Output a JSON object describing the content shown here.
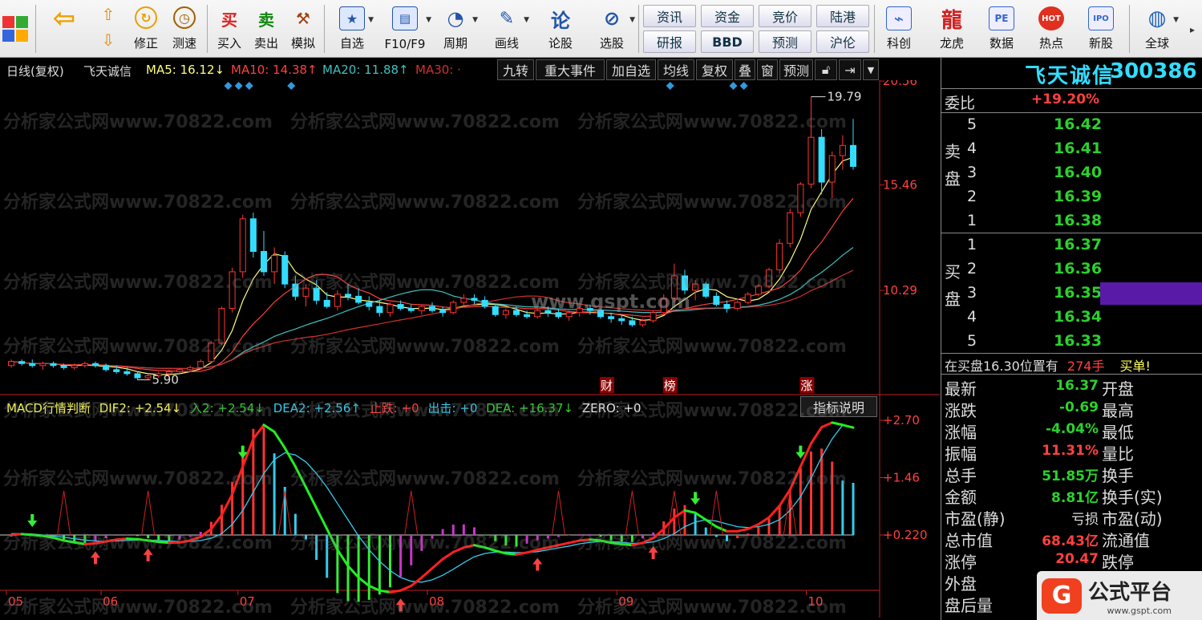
{
  "toolbar": {
    "buttons": [
      {
        "name": "back",
        "label": ""
      },
      {
        "name": "revise",
        "label": "修正"
      },
      {
        "name": "speed-test",
        "label": "测速"
      },
      {
        "name": "buy",
        "label": "买入"
      },
      {
        "name": "sell",
        "label": "卖出"
      },
      {
        "name": "simulate",
        "label": "模拟"
      },
      {
        "name": "self-select",
        "label": "自选"
      },
      {
        "name": "f10",
        "label": "F10/F9"
      },
      {
        "name": "period",
        "label": "周期"
      },
      {
        "name": "draw-line",
        "label": "画线"
      },
      {
        "name": "stock-forum",
        "label": "论股"
      },
      {
        "name": "stock-select",
        "label": "选股"
      },
      {
        "name": "kechuang",
        "label": "科创"
      },
      {
        "name": "dragon-tiger",
        "label": "龙虎"
      },
      {
        "name": "data",
        "label": "数据"
      },
      {
        "name": "hotspot",
        "label": "热点"
      },
      {
        "name": "new-stock",
        "label": "新股"
      },
      {
        "name": "global",
        "label": "全球"
      }
    ],
    "text_buttons": [
      "资讯",
      "资金",
      "竞价",
      "陆港",
      "研报",
      "BBD",
      "预测",
      "沪伦"
    ],
    "icon_glyphs": {
      "buy": "买",
      "sell": "卖",
      "stock-forum": "论",
      "pe": "PE",
      "ipo": "IPO",
      "hot": "HOT"
    }
  },
  "header": {
    "period_label": "日线(复权)",
    "stock_name": "飞天诚信",
    "ma5": "MA5: 16.12↓",
    "ma10": "MA10: 14.38↑",
    "ma20": "MA20: 11.88↑",
    "ma30": "MA30: ·",
    "buttons": [
      "九转",
      "重大事件",
      "加自选",
      "均线",
      "复权",
      "叠",
      "窗",
      "预测"
    ]
  },
  "title": {
    "name": "飞天诚信",
    "code": "300386"
  },
  "order_ratio": {
    "label": "委比",
    "value": "+19.20%"
  },
  "sell_side": {
    "label": "卖盘",
    "levels": [
      {
        "n": "5",
        "price": "16.42"
      },
      {
        "n": "4",
        "price": "16.41"
      },
      {
        "n": "3",
        "price": "16.40"
      },
      {
        "n": "2",
        "price": "16.39"
      },
      {
        "n": "1",
        "price": "16.38"
      }
    ]
  },
  "buy_side": {
    "label": "买盘",
    "levels": [
      {
        "n": "1",
        "price": "16.37"
      },
      {
        "n": "2",
        "price": "16.36"
      },
      {
        "n": "3",
        "price": "16.35"
      },
      {
        "n": "4",
        "price": "16.34"
      },
      {
        "n": "5",
        "price": "16.33"
      }
    ]
  },
  "notice": {
    "prefix": "在买盘16.30位置有",
    "qty": "274手",
    "suffix": "买单!"
  },
  "quote": {
    "latest": {
      "label": "最新",
      "value": "16.37",
      "right": "开盘"
    },
    "change": {
      "label": "涨跌",
      "value": "-0.69",
      "right": "最高"
    },
    "change_pct": {
      "label": "涨幅",
      "value": "-4.04%",
      "right": "最低"
    },
    "amplitude": {
      "label": "振幅",
      "value": "11.31%",
      "right": "量比"
    },
    "volume": {
      "label": "总手",
      "value": "51.85万",
      "right": "换手"
    },
    "amount": {
      "label": "金额",
      "value": "8.81亿",
      "right": "换手(实)"
    },
    "pe_static": {
      "label": "市盈(静)",
      "value": "亏损",
      "right": "市盈(动)"
    },
    "market_cap": {
      "label": "总市值",
      "value": "68.43亿",
      "right": "流通值"
    },
    "limit_up": {
      "label": "涨停",
      "value": "20.47",
      "right": "跌停"
    },
    "outer": {
      "label": "外盘"
    },
    "after_hours": {
      "label": "盘后量"
    }
  },
  "brand": {
    "name": "公式平台",
    "site": "www.gspt.com"
  },
  "watermark": {
    "text": "分析家公式网www.70822.com",
    "center": "www.gspt.com"
  },
  "colors": {
    "up": "#ff3333",
    "down": "#33ddff",
    "ma5": "#ffff80",
    "ma10": "#ff4040",
    "ma20": "#40c0c0",
    "ma30": "#d03030",
    "dif": "#ff2020",
    "dea": "#33ccee"
  },
  "chart_data": [
    {
      "type": "candlestick",
      "title": "日线(复权) 飞天诚信",
      "y_ticks": [
        "20.56",
        "15.46",
        "10.29"
      ],
      "ylim": [
        4.8,
        21.2
      ],
      "x_ticks": [
        "05",
        "06",
        "07",
        "08",
        "09",
        "10"
      ],
      "annotations": {
        "high": "19.79",
        "low": "5.90",
        "markers": [
          "财",
          "榜",
          "涨"
        ]
      },
      "candles": [
        [
          6.6,
          6.9,
          6.5,
          6.8
        ],
        [
          6.8,
          6.9,
          6.6,
          6.7
        ],
        [
          6.7,
          6.9,
          6.5,
          6.6
        ],
        [
          6.6,
          6.8,
          6.4,
          6.7
        ],
        [
          6.7,
          6.8,
          6.5,
          6.6
        ],
        [
          6.6,
          6.7,
          6.4,
          6.5
        ],
        [
          6.5,
          6.7,
          6.4,
          6.6
        ],
        [
          6.6,
          6.8,
          6.5,
          6.7
        ],
        [
          6.7,
          6.8,
          6.5,
          6.6
        ],
        [
          6.6,
          6.7,
          6.3,
          6.4
        ],
        [
          6.4,
          6.6,
          6.2,
          6.3
        ],
        [
          6.3,
          6.5,
          6.1,
          6.2
        ],
        [
          6.2,
          6.3,
          5.9,
          6.0
        ],
        [
          6.0,
          6.2,
          5.9,
          6.1
        ],
        [
          6.1,
          6.3,
          6.0,
          6.2
        ],
        [
          6.2,
          6.4,
          6.1,
          6.3
        ],
        [
          6.3,
          6.5,
          6.2,
          6.4
        ],
        [
          6.4,
          6.6,
          6.3,
          6.5
        ],
        [
          6.5,
          6.9,
          6.4,
          6.8
        ],
        [
          6.8,
          7.8,
          6.7,
          7.7
        ],
        [
          7.7,
          9.5,
          7.6,
          9.4
        ],
        [
          9.4,
          11.4,
          9.2,
          11.2
        ],
        [
          11.2,
          14.0,
          10.9,
          13.8
        ],
        [
          13.8,
          14.1,
          11.9,
          12.2
        ],
        [
          12.2,
          13.2,
          11.0,
          11.2
        ],
        [
          11.2,
          12.4,
          10.6,
          12.0
        ],
        [
          12.0,
          12.2,
          10.4,
          10.6
        ],
        [
          10.6,
          11.0,
          9.8,
          10.0
        ],
        [
          10.0,
          10.6,
          9.5,
          10.4
        ],
        [
          10.4,
          10.8,
          9.6,
          9.8
        ],
        [
          9.8,
          10.2,
          9.4,
          9.5
        ],
        [
          9.5,
          10.3,
          9.3,
          10.1
        ],
        [
          10.1,
          10.6,
          9.8,
          10.0
        ],
        [
          10.0,
          10.4,
          9.6,
          9.7
        ],
        [
          9.7,
          10.0,
          9.3,
          9.5
        ],
        [
          9.5,
          9.8,
          9.0,
          9.2
        ],
        [
          9.2,
          9.7,
          9.0,
          9.6
        ],
        [
          9.6,
          9.8,
          9.3,
          9.4
        ],
        [
          9.4,
          9.6,
          9.2,
          9.3
        ],
        [
          9.3,
          9.6,
          9.1,
          9.5
        ],
        [
          9.5,
          9.7,
          9.2,
          9.3
        ],
        [
          9.3,
          9.5,
          9.0,
          9.2
        ],
        [
          9.2,
          9.8,
          9.1,
          9.7
        ],
        [
          9.7,
          10.1,
          9.5,
          9.9
        ],
        [
          9.9,
          10.1,
          9.6,
          9.8
        ],
        [
          9.8,
          10.0,
          9.4,
          9.5
        ],
        [
          9.5,
          9.6,
          9.0,
          9.1
        ],
        [
          9.1,
          9.4,
          8.9,
          9.3
        ],
        [
          9.3,
          9.5,
          9.0,
          9.1
        ],
        [
          9.1,
          9.3,
          8.9,
          9.0
        ],
        [
          9.0,
          9.4,
          8.9,
          9.3
        ],
        [
          9.3,
          9.5,
          9.0,
          9.2
        ],
        [
          9.2,
          9.4,
          8.9,
          9.0
        ],
        [
          9.0,
          9.3,
          8.8,
          9.2
        ],
        [
          9.2,
          9.5,
          9.0,
          9.4
        ],
        [
          9.4,
          9.6,
          9.1,
          9.3
        ],
        [
          9.3,
          9.4,
          8.9,
          9.0
        ],
        [
          9.0,
          9.2,
          8.7,
          8.9
        ],
        [
          8.9,
          9.1,
          8.6,
          8.8
        ],
        [
          8.8,
          9.0,
          8.5,
          8.6
        ],
        [
          8.6,
          8.9,
          8.5,
          8.8
        ],
        [
          8.8,
          9.3,
          8.7,
          9.2
        ],
        [
          9.2,
          10.1,
          9.1,
          9.9
        ],
        [
          9.9,
          11.6,
          9.7,
          11.0
        ],
        [
          11.0,
          11.3,
          10.1,
          10.3
        ],
        [
          10.3,
          10.8,
          9.8,
          10.6
        ],
        [
          10.6,
          10.7,
          9.9,
          10.0
        ],
        [
          10.0,
          10.2,
          9.5,
          9.6
        ],
        [
          9.6,
          9.8,
          9.2,
          9.4
        ],
        [
          9.4,
          9.8,
          9.3,
          9.7
        ],
        [
          9.7,
          10.2,
          9.6,
          10.1
        ],
        [
          10.1,
          10.6,
          10.0,
          10.5
        ],
        [
          10.5,
          11.4,
          10.4,
          11.3
        ],
        [
          11.3,
          12.8,
          11.1,
          12.6
        ],
        [
          12.6,
          14.3,
          12.4,
          14.1
        ],
        [
          14.1,
          15.6,
          13.9,
          15.5
        ],
        [
          15.5,
          19.79,
          15.3,
          17.8
        ],
        [
          17.8,
          18.2,
          15.0,
          15.6
        ],
        [
          15.6,
          17.1,
          14.8,
          16.9
        ],
        [
          16.9,
          17.9,
          16.2,
          17.4
        ],
        [
          17.4,
          18.7,
          16.2,
          16.37
        ]
      ]
    },
    {
      "type": "line",
      "title": "MACD行情判断",
      "legend": [
        "DIF2: +2.54↓",
        "入2: +2.54↓",
        "DEA2: +2.56↑",
        "止跌: +0",
        "出击: +0",
        "DEA: +16.37↓",
        "ZERO: +0"
      ],
      "y_ticks": [
        "+2.70",
        "+1.46",
        "+0.220"
      ],
      "ylim": [
        -1.2,
        2.9
      ],
      "series": [
        {
          "name": "DIF2",
          "values": [
            0.22,
            0.24,
            0.22,
            0.2,
            0.16,
            0.1,
            0.06,
            0.02,
            0.04,
            0.08,
            0.12,
            0.14,
            0.13,
            0.1,
            0.07,
            0.05,
            0.06,
            0.1,
            0.18,
            0.35,
            0.65,
            1.1,
            1.7,
            2.3,
            2.6,
            2.45,
            2.1,
            1.7,
            1.25,
            0.8,
            0.35,
            -0.1,
            -0.45,
            -0.7,
            -0.88,
            -0.98,
            -1.02,
            -0.98,
            -0.88,
            -0.7,
            -0.5,
            -0.3,
            -0.15,
            -0.05,
            0.0,
            -0.05,
            -0.12,
            -0.18,
            -0.2,
            -0.16,
            -0.1,
            -0.05,
            0.0,
            0.05,
            0.1,
            0.12,
            0.1,
            0.05,
            0.02,
            0.0,
            0.05,
            0.15,
            0.35,
            0.6,
            0.75,
            0.7,
            0.55,
            0.4,
            0.3,
            0.3,
            0.35,
            0.45,
            0.6,
            0.85,
            1.2,
            1.7,
            2.2,
            2.55,
            2.65,
            2.6,
            2.54
          ]
        },
        {
          "name": "DEA2",
          "values": [
            0.25,
            0.25,
            0.24,
            0.22,
            0.2,
            0.17,
            0.14,
            0.11,
            0.09,
            0.08,
            0.09,
            0.1,
            0.11,
            0.11,
            0.1,
            0.09,
            0.08,
            0.08,
            0.1,
            0.15,
            0.25,
            0.45,
            0.75,
            1.15,
            1.55,
            1.85,
            2.0,
            1.95,
            1.8,
            1.55,
            1.25,
            0.9,
            0.55,
            0.2,
            -0.1,
            -0.35,
            -0.55,
            -0.7,
            -0.78,
            -0.8,
            -0.75,
            -0.65,
            -0.52,
            -0.38,
            -0.25,
            -0.18,
            -0.15,
            -0.15,
            -0.16,
            -0.16,
            -0.14,
            -0.1,
            -0.06,
            -0.02,
            0.03,
            0.06,
            0.08,
            0.08,
            0.06,
            0.04,
            0.04,
            0.07,
            0.14,
            0.25,
            0.4,
            0.5,
            0.55,
            0.52,
            0.46,
            0.4,
            0.38,
            0.4,
            0.45,
            0.55,
            0.75,
            1.05,
            1.45,
            1.9,
            2.3,
            2.6,
            2.56
          ]
        }
      ],
      "x_ticks": [
        "05",
        "06",
        "07",
        "08",
        "09",
        "10"
      ]
    }
  ]
}
